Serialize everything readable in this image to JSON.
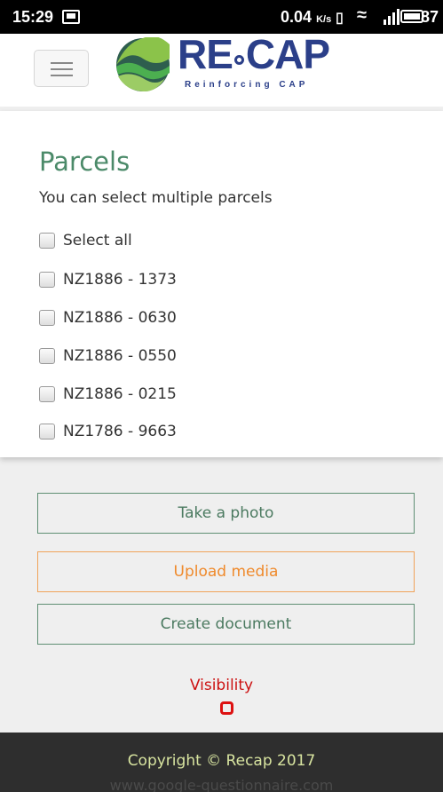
{
  "status_bar": {
    "time": "15:29",
    "net_speed_value": "0.04",
    "net_speed_unit": "K/s",
    "battery_level": "87"
  },
  "header": {
    "logo_text_left": "RE",
    "logo_text_right": "CAP",
    "logo_tagline": "Reinforcing CAP",
    "brand_color": "#2b3f89",
    "logo_colors": [
      "#4caf50",
      "#8bc34a",
      "#2e5e4e"
    ]
  },
  "parcels": {
    "title": "Parcels",
    "subtitle": "You can select multiple parcels",
    "select_all_label": "Select all",
    "items": [
      {
        "label": "NZ1886 - 1373"
      },
      {
        "label": "NZ1886 - 0630"
      },
      {
        "label": "NZ1886 - 0550"
      },
      {
        "label": "NZ1886 - 0215"
      },
      {
        "label": "NZ1786 - 9663"
      }
    ]
  },
  "actions": {
    "take_photo": "Take a photo",
    "upload_media": "Upload media",
    "create_document": "Create document"
  },
  "visibility": {
    "label": "Visibility"
  },
  "footer": {
    "copyright": "Copyright © Recap 2017",
    "url": "www.google-questionnaire.com"
  },
  "colors": {
    "accent_green": "#4b8a69",
    "accent_orange": "#ef8a2c",
    "visibility_red": "#cc1111",
    "footer_bg": "#2e2e2e"
  }
}
